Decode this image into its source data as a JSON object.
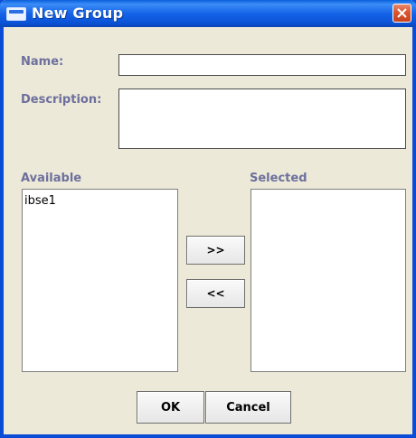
{
  "window": {
    "title": "New Group"
  },
  "form": {
    "name_label": "Name:",
    "name_value": "",
    "description_label": "Description:",
    "description_value": ""
  },
  "available": {
    "label": "Available",
    "items": [
      "ibse1"
    ]
  },
  "selected": {
    "label": "Selected",
    "items": []
  },
  "transfer": {
    "add_label": ">>",
    "remove_label": "<<"
  },
  "actions": {
    "ok_label": "OK",
    "cancel_label": "Cancel"
  },
  "colors": {
    "title_bar": "#0a52d6",
    "label_text": "#6d6f9d",
    "dialog_bg": "#ece9d8",
    "close_button": "#d9552f"
  }
}
